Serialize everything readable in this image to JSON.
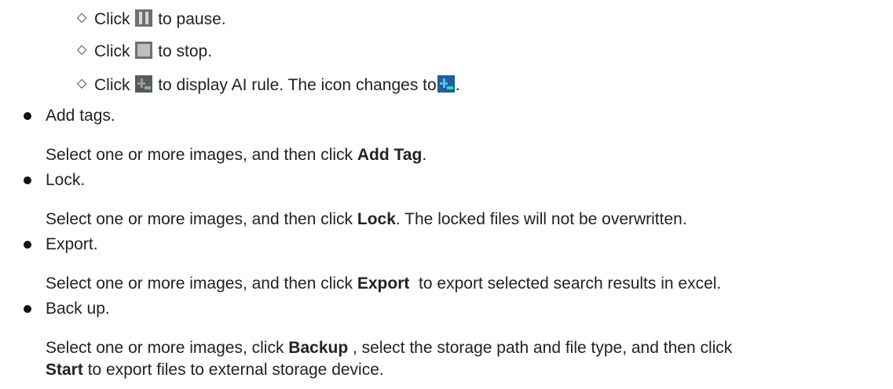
{
  "playback_items": [
    {
      "prefix": "Click",
      "icon": "pause-icon",
      "suffix": "to pause."
    },
    {
      "prefix": "Click",
      "icon": "stop-icon",
      "suffix": "to stop."
    },
    {
      "prefix": "Click",
      "icon": "ai-rule-icon",
      "suffix": "to display AI rule. The icon changes to",
      "end_icon": "ai-rule-active-icon",
      "end": "."
    }
  ],
  "actions": [
    {
      "title": "Add tags.",
      "desc_pre": "Select one or more images, and then click ",
      "bold": "Add Tag",
      "desc_post": "."
    },
    {
      "title": "Lock.",
      "desc_pre": "Select one or more images, and then click ",
      "bold": "Lock",
      "desc_post": ". The locked files will not be overwritten."
    },
    {
      "title": "Export.",
      "desc_pre": "Select one or more images, and then click ",
      "bold": "Export",
      "desc_post": "  to export selected search results in excel."
    },
    {
      "title": "Back up.",
      "desc_pre": "Select one or more images, click ",
      "bold": "Backup",
      "desc_post": " , select the storage path and file type, and then click",
      "desc2_bold": "Start",
      "desc2_post": " to export files to external storage device."
    }
  ],
  "colors": {
    "icon_gray": "#8a8a8a",
    "icon_blue": "#1e8fd8",
    "text": "#222222"
  }
}
